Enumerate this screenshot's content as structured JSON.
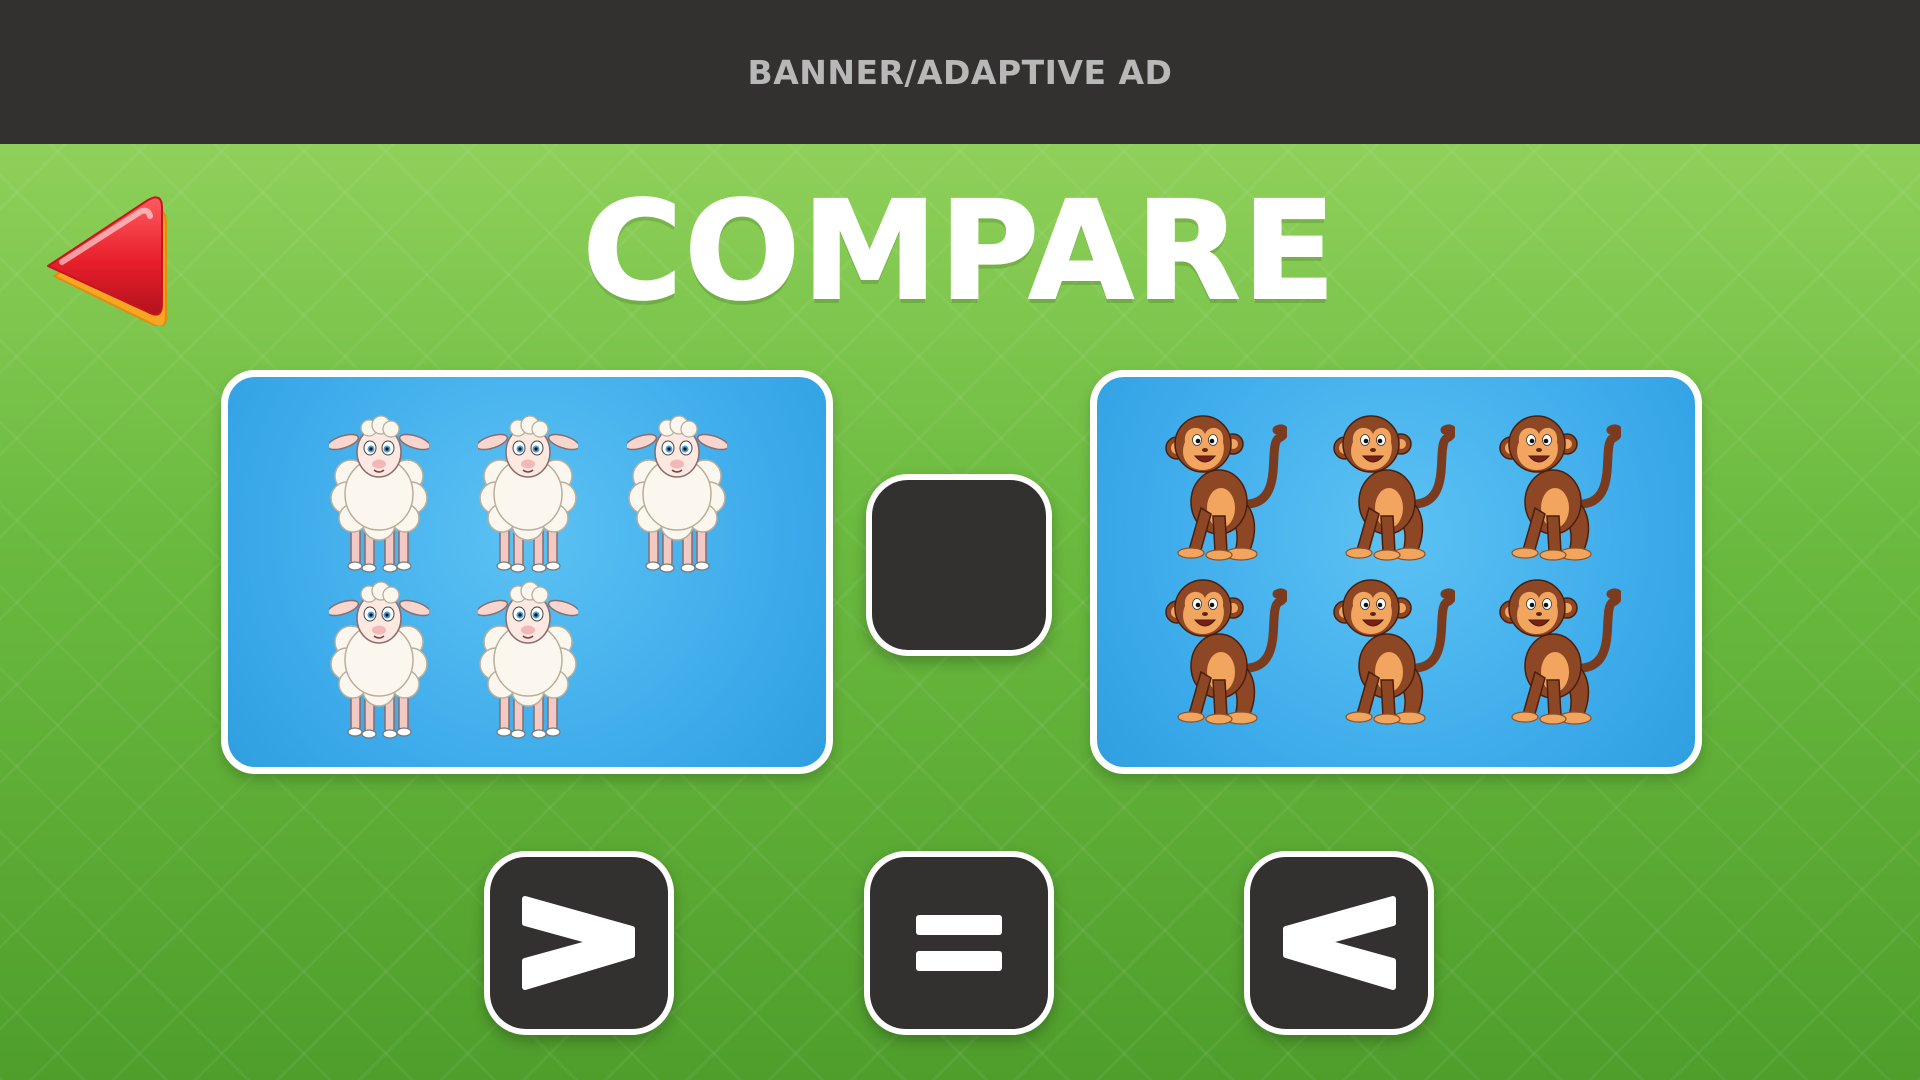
{
  "ad_banner": {
    "label": "BANNER/ADAPTIVE AD"
  },
  "header": {
    "title": "COMPARE",
    "back_icon": "back-arrow-icon"
  },
  "left_group": {
    "animal": "sheep",
    "count": 5
  },
  "right_group": {
    "animal": "monkey",
    "count": 6
  },
  "answer_slot": {
    "value": ""
  },
  "operators": [
    {
      "symbol": ">",
      "name": "greater-than"
    },
    {
      "symbol": "=",
      "name": "equals"
    },
    {
      "symbol": "<",
      "name": "less-than"
    }
  ],
  "colors": {
    "background_green": "#6cbb40",
    "panel_blue": "#3ba9ea",
    "button_dark": "#333030",
    "back_red": "#e8232f"
  }
}
